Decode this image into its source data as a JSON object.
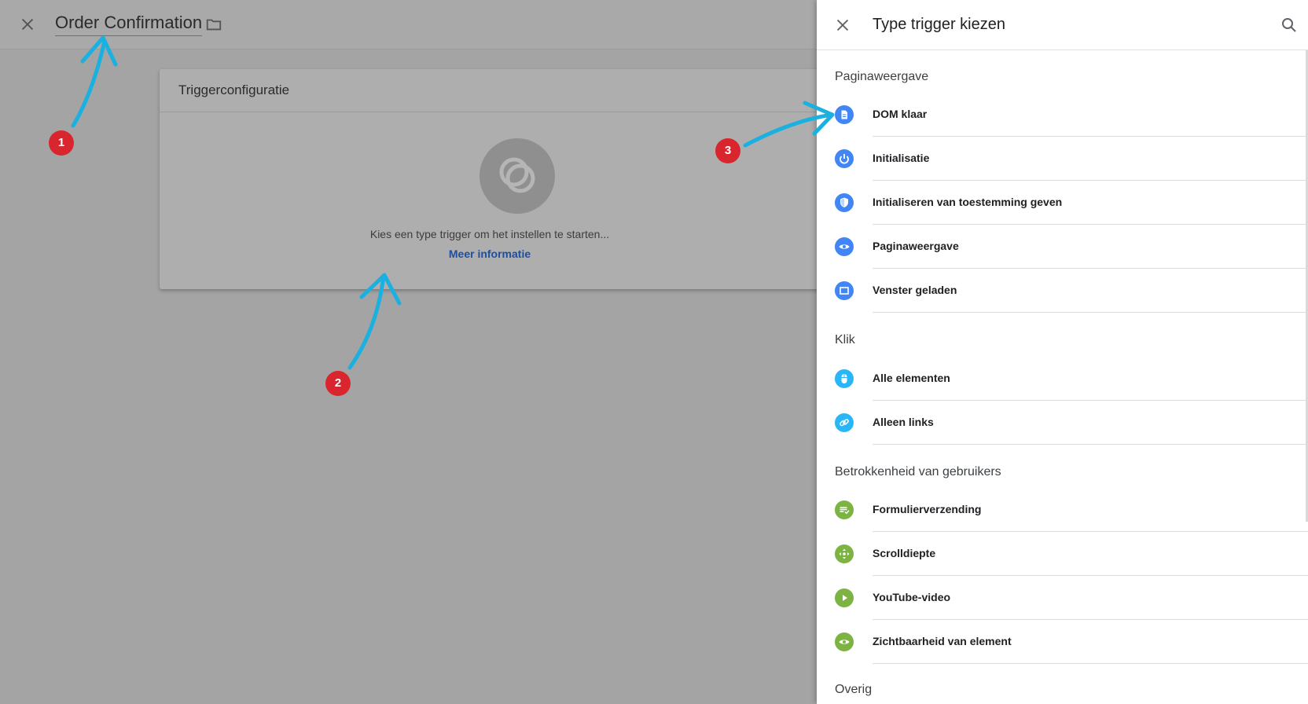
{
  "editor": {
    "title": "Order Confirmation",
    "card": {
      "header": "Triggerconfiguratie",
      "message": "Kies een type trigger om het instellen te starten...",
      "link": "Meer informatie"
    }
  },
  "panel": {
    "title": "Type trigger kiezen",
    "sections": [
      {
        "title": "Paginaweergave",
        "items": [
          {
            "label": "DOM klaar",
            "icon": "document-icon",
            "color": "#4285f4"
          },
          {
            "label": "Initialisatie",
            "icon": "power-icon",
            "color": "#4285f4"
          },
          {
            "label": "Initialiseren van toestemming geven",
            "icon": "shield-icon",
            "color": "#4285f4"
          },
          {
            "label": "Paginaweergave",
            "icon": "eye-icon",
            "color": "#4285f4"
          },
          {
            "label": "Venster geladen",
            "icon": "window-icon",
            "color": "#4285f4"
          }
        ]
      },
      {
        "title": "Klik",
        "items": [
          {
            "label": "Alle elementen",
            "icon": "mouse-icon",
            "color": "#29b6f6"
          },
          {
            "label": "Alleen links",
            "icon": "link-icon",
            "color": "#29b6f6"
          }
        ]
      },
      {
        "title": "Betrokkenheid van gebruikers",
        "items": [
          {
            "label": "Formulierverzending",
            "icon": "form-check-icon",
            "color": "#7cb342"
          },
          {
            "label": "Scrolldiepte",
            "icon": "move-arrows-icon",
            "color": "#7cb342"
          },
          {
            "label": "YouTube-video",
            "icon": "play-icon",
            "color": "#7cb342"
          },
          {
            "label": "Zichtbaarheid van element",
            "icon": "eye-icon",
            "color": "#7cb342"
          }
        ]
      },
      {
        "title": "Overig",
        "items": []
      }
    ]
  },
  "annotations": [
    {
      "label": "1"
    },
    {
      "label": "2"
    },
    {
      "label": "3"
    }
  ],
  "colors": {
    "annotation_arrow": "#1ab0e0",
    "annotation_badge": "#d9262e",
    "link": "#1c4fa0"
  }
}
